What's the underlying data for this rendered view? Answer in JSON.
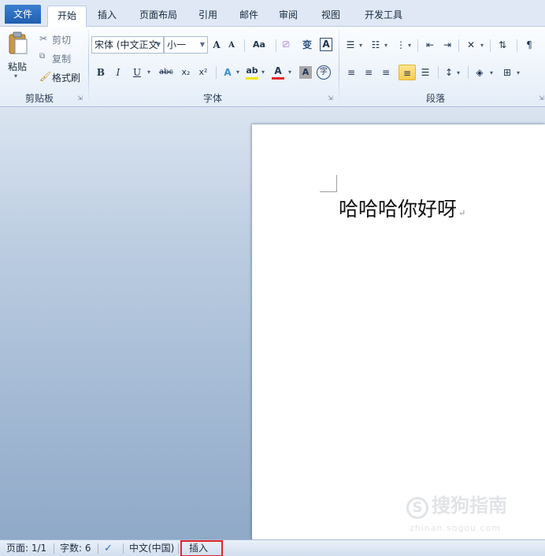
{
  "tabs": [
    "文件",
    "开始",
    "插入",
    "页面布局",
    "引用",
    "邮件",
    "审阅",
    "视图",
    "开发工具"
  ],
  "active_tab": "开始",
  "clipboard": {
    "paste_label": "粘贴",
    "cut_label": "剪切",
    "copy_label": "复制",
    "format_painter_label": "格式刷",
    "group_label": "剪贴板"
  },
  "font": {
    "font_name": "宋体 (中文正文",
    "font_size": "小一",
    "grow_font": "A",
    "shrink_font": "A",
    "change_case": "Aa",
    "pinyin_guide": "变",
    "char_border": "A",
    "bold": "B",
    "italic": "I",
    "underline": "U",
    "strikethrough": "abc",
    "subscript": "x₂",
    "superscript": "x²",
    "text_effect": "A",
    "highlight": "ab",
    "font_color": "A",
    "char_shading": "A",
    "enclose_char": "字",
    "group_label": "字体",
    "font_color_hex": "#e3262b",
    "highlight_color_hex": "#f5e50a"
  },
  "paragraph": {
    "group_label": "段落"
  },
  "document": {
    "text": "哈哈哈你好呀",
    "para_mark": "↵"
  },
  "watermark": {
    "line1": "搜狗指南",
    "line2": "zhinan.sogou.com"
  },
  "status": {
    "page": "页面: 1/1",
    "word_count": "字数: 6",
    "language": "中文(中国)",
    "mode": "插入"
  }
}
